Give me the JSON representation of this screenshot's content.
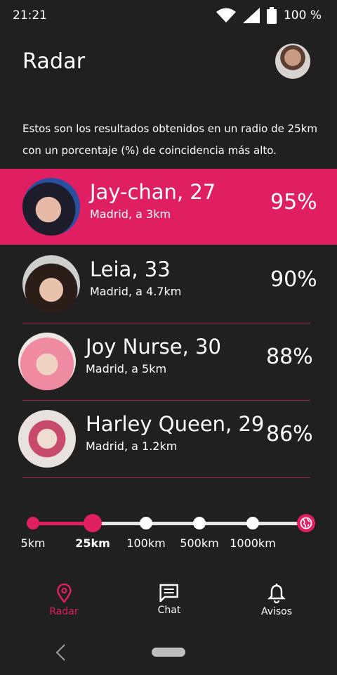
{
  "status": {
    "time": "21:21",
    "battery": "100 %"
  },
  "header": {
    "title": "Radar"
  },
  "description": "Estos son los resultados obtenidos en un radio de 25km con un porcentaje (%) de coincidencia más alto.",
  "results": [
    {
      "name": "Jay-chan, 27",
      "location": "Madrid, a 3km",
      "percent": "95%",
      "active": true
    },
    {
      "name": "Leia, 33",
      "location": "Madrid, a 4.7km",
      "percent": "90%",
      "active": false
    },
    {
      "name": "Joy Nurse, 30",
      "location": "Madrid, a 5km",
      "percent": "88%",
      "active": false
    },
    {
      "name": "Harley Queen, 29",
      "location": "Madrid, a 1.2km",
      "percent": "86%",
      "active": false
    }
  ],
  "radius_slider": {
    "labels": [
      "5km",
      "25km",
      "100km",
      "500km",
      "1000km"
    ],
    "selected": "25km"
  },
  "bottom_nav": [
    {
      "label": "Radar",
      "icon": "location-pin-icon"
    },
    {
      "label": "Chat",
      "icon": "chat-icon"
    },
    {
      "label": "Avisos",
      "icon": "bell-icon"
    }
  ],
  "colors": {
    "accent": "#e01f63",
    "background": "#202020"
  }
}
